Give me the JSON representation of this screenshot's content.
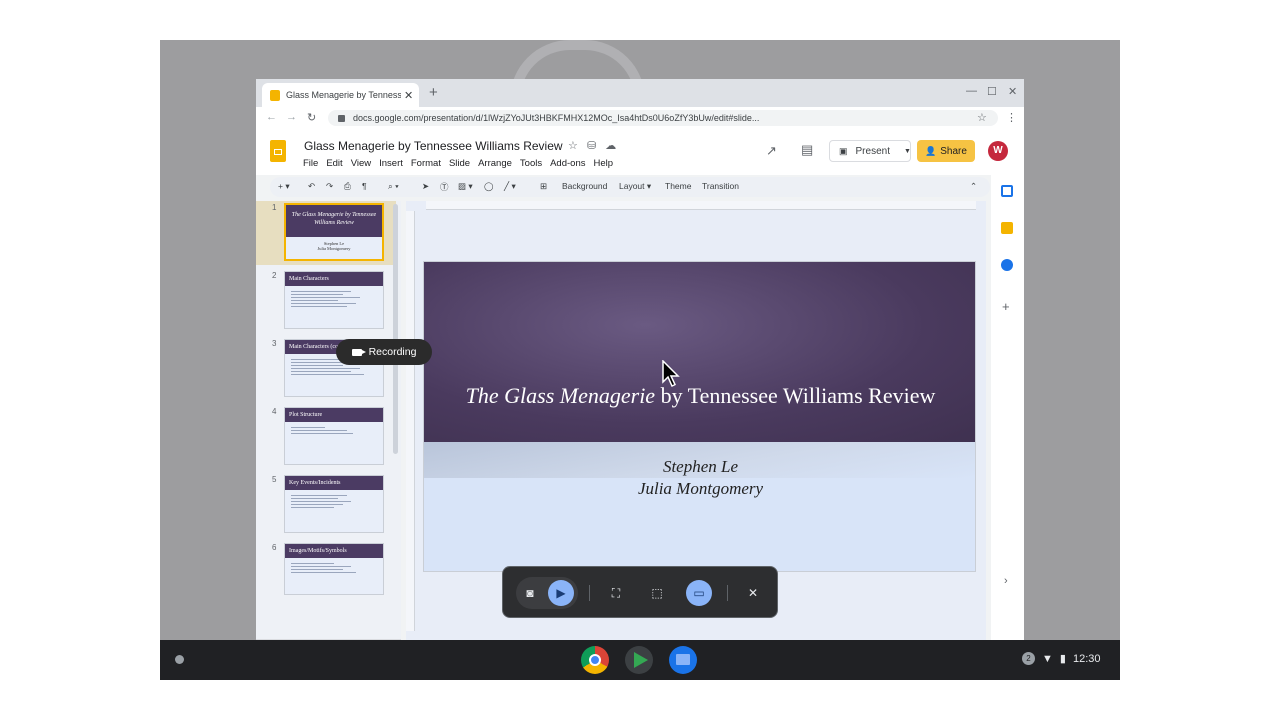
{
  "browser": {
    "tab_title": "Glass Menagerie by Tennessee Williams Review - Google Slides",
    "url": "docs.google.com/presentation/d/1lWzjZYoJUt3HBKFMHX12MOc_Isa4htDs0U6oZfY3bUw/edit#slide..."
  },
  "doc": {
    "title": "Glass Menagerie by Tennessee Williams Review",
    "menu": [
      "File",
      "Edit",
      "View",
      "Insert",
      "Format",
      "Slide",
      "Arrange",
      "Tools",
      "Add-ons",
      "Help"
    ],
    "present_label": "Present",
    "share_label": "Share"
  },
  "toolbar": {
    "background": "Background",
    "layout": "Layout",
    "theme": "Theme",
    "transition": "Transition"
  },
  "thumbnails": [
    {
      "num": "1",
      "title": "The Glass Menagerie by Tennessee Williams Review",
      "sub1": "Stephen Le",
      "sub2": "Julia Montgomery"
    },
    {
      "num": "2",
      "title": "Main Characters"
    },
    {
      "num": "3",
      "title": "Main Characters (cont'd)"
    },
    {
      "num": "4",
      "title": "Plot Structure"
    },
    {
      "num": "5",
      "title": "Key Events/Incidents"
    },
    {
      "num": "6",
      "title": "Images/Motifs/Symbols"
    }
  ],
  "slide": {
    "title_italic": "The Glass Menagerie",
    "title_rest": " by Tennessee Williams Review",
    "author1": "Stephen Le",
    "author2": "Julia Montgomery"
  },
  "recording": {
    "label": "Recording"
  },
  "shelf": {
    "time": "12:30",
    "notification_count": "2"
  },
  "colors": {
    "accent_yellow": "#f4b400",
    "slide_purple": "#4a3a5e",
    "capture_selected": "#8ab4f8"
  }
}
